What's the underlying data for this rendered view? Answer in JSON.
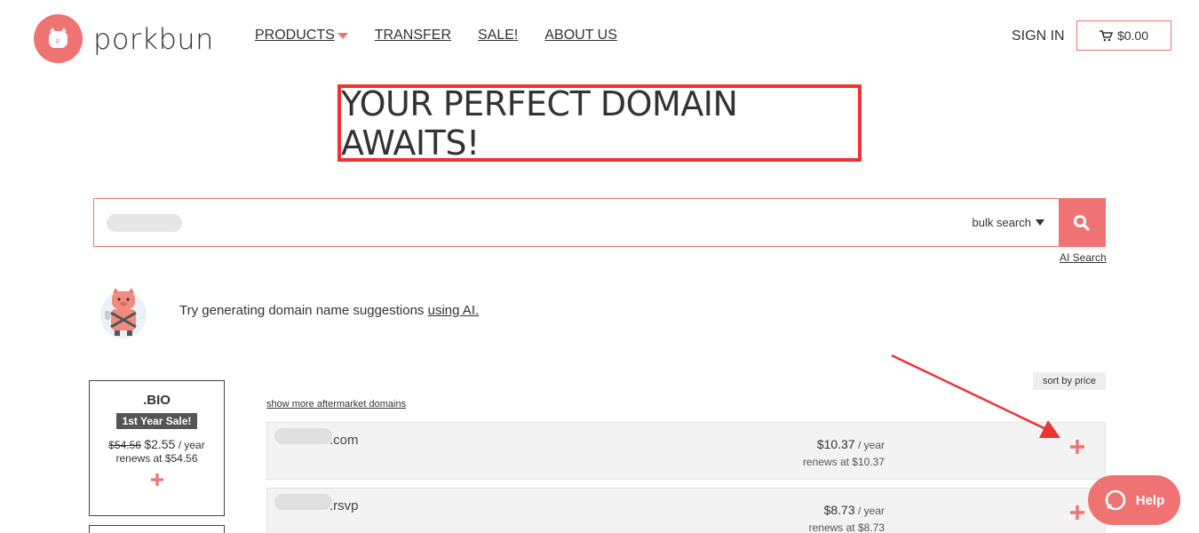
{
  "brand": {
    "name": "porkbun"
  },
  "nav": {
    "products": "PRODUCTS",
    "transfer": "TRANSFER",
    "sale": "SALE!",
    "about": "ABOUT US"
  },
  "header": {
    "signin": "SIGN IN",
    "cart_total": "$0.00"
  },
  "hero": {
    "title": "YOUR PERFECT DOMAIN AWAITS!"
  },
  "search": {
    "value": "x.com",
    "bulk_label": "bulk search",
    "ai_link": "AI Search"
  },
  "ai_suggest": {
    "text": "Try generating domain name suggestions ",
    "link": "using AI."
  },
  "sale_card": {
    "tld": ".BIO",
    "badge": "1st Year Sale!",
    "old_price": "$54.56",
    "new_price": "$2.55",
    "per": " / year",
    "renews": "renews at $54.56"
  },
  "results": {
    "sort_label": "sort by price",
    "aftermarket_link": "show more aftermarket domains",
    "rows": [
      {
        "domain": ".com",
        "price": "$10.37",
        "unit": " / year",
        "renews": "renews at $10.37"
      },
      {
        "domain": ".rsvp",
        "price": "$8.73",
        "unit": " / year",
        "renews": "renews at $8.73"
      }
    ]
  },
  "help": {
    "label": "Help"
  },
  "colors": {
    "accent": "#ef7373",
    "annotation": "#ee3333"
  }
}
